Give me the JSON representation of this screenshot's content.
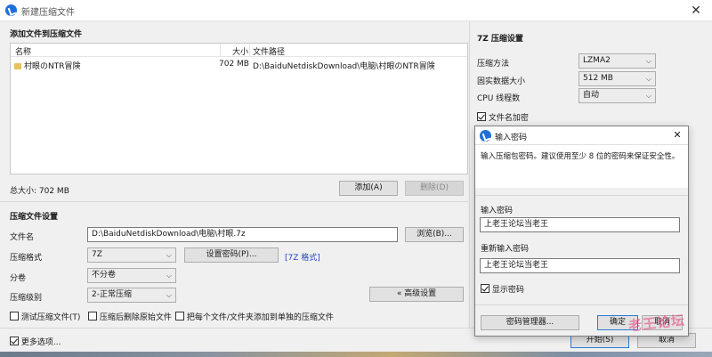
{
  "window": {
    "title": "新建压缩文件",
    "close_glyph": "✕"
  },
  "files_panel": {
    "heading": "添加文件到压缩文件",
    "col_name": "名称",
    "col_size": "大小",
    "col_path": "文件路径",
    "rows": [
      {
        "name": "村眼のNTR冒険",
        "size": "702 MB",
        "path": "D:\\BaiduNetdiskDownload\\电脑\\村眼のNTR冒険"
      }
    ],
    "total_label": "总大小: 702 MB",
    "add_button": "添加(A)",
    "delete_button": "删除(D)"
  },
  "settings": {
    "heading": "压缩文件设置",
    "filename_label": "文件名",
    "filename_value": "D:\\BaiduNetdiskDownload\\电脑\\村眼.7z",
    "browse_button": "浏览(B)...",
    "format_label": "压缩格式",
    "format_value": "7Z",
    "set_password_button": "设置密码(P)...",
    "format_link": "[7Z 格式]",
    "split_label": "分卷",
    "split_value": "不分卷",
    "level_label": "压缩级别",
    "level_value": "2-正常压缩",
    "advanced_button": "« 高级设置",
    "test_checkbox": "测试压缩文件(T)",
    "delete_after_checkbox": "压缩后删除原始文件",
    "each_separate_checkbox": "把每个文件/文件夹添加到单独的压缩文件",
    "more_options_checkbox": "更多选项...",
    "start_button": "开始(S)",
    "cancel_button": "取消"
  },
  "sevenz": {
    "heading": "7Z 压缩设置",
    "method_label": "压缩方法",
    "method_value": "LZMA2",
    "solid_label": "固实数据大小",
    "solid_value": "512 MB",
    "threads_label": "CPU 线程数",
    "threads_value": "自动",
    "encrypt_names_label": "文件名加密"
  },
  "password_dialog": {
    "title": "输入密码",
    "description": "输入压缩包密码。建议使用至少 8 位的密码来保证安全性。",
    "enter_label": "输入密码",
    "enter_value": "上老王论坛当老王",
    "reenter_label": "重新输入密码",
    "reenter_value": "上老王论坛当老王",
    "show_password_label": "显示密码",
    "manager_button": "密码管理器...",
    "ok_button": "确定",
    "cancel_button": "取消",
    "close_glyph": "✕"
  },
  "watermark": "老王论坛",
  "colors": {
    "accent": "#1e6fd9",
    "link": "#2045c8",
    "window_bg": "#f0f0f0"
  }
}
